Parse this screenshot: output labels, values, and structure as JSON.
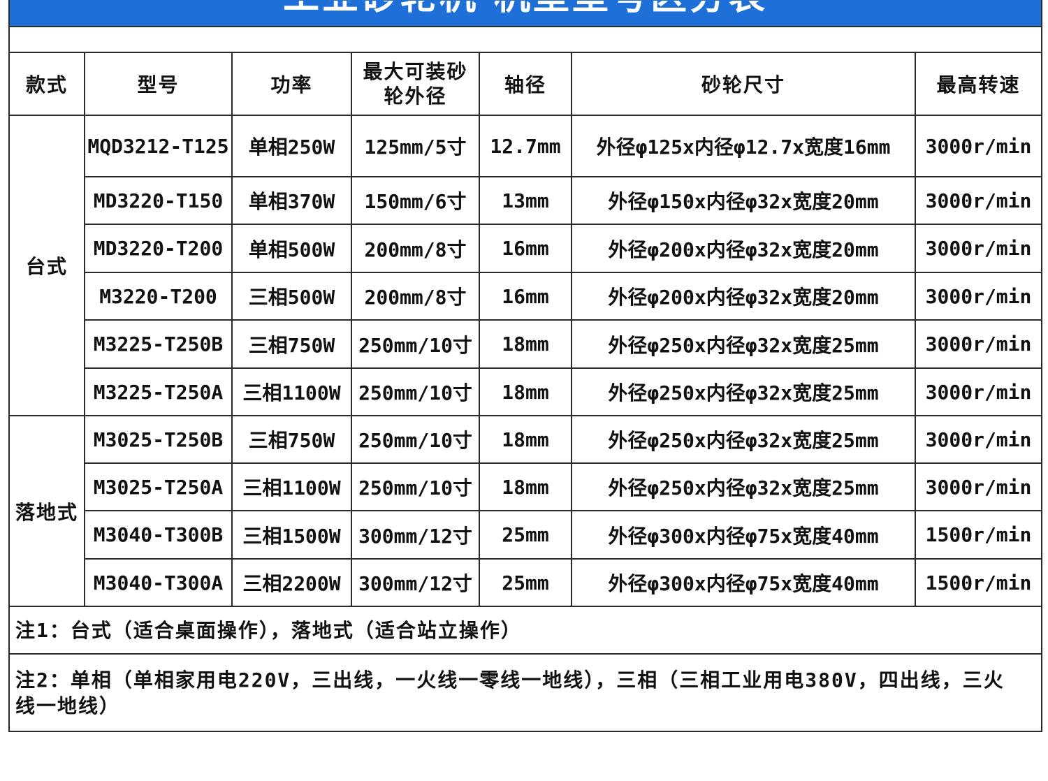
{
  "title": "工业砂轮机 机型型号区分表",
  "columns": {
    "style": "款式",
    "model": "型号",
    "power": "功率",
    "wheel_od": "最大可装砂轮外径",
    "shaft": "轴径",
    "wheel_size": "砂轮尺寸",
    "max_speed": "最高转速"
  },
  "groups": [
    {
      "style": "台式",
      "rows": [
        {
          "model": "MQD3212-T125",
          "power": "单相250W",
          "wheel_od": "125mm/5寸",
          "shaft": "12.7mm",
          "wheel_size": "外径φ125x内径φ12.7x宽度16mm",
          "max_speed": "3000r/min"
        },
        {
          "model": "MD3220-T150",
          "power": "单相370W",
          "wheel_od": "150mm/6寸",
          "shaft": "13mm",
          "wheel_size": "外径φ150x内径φ32x宽度20mm",
          "max_speed": "3000r/min"
        },
        {
          "model": "MD3220-T200",
          "power": "单相500W",
          "wheel_od": "200mm/8寸",
          "shaft": "16mm",
          "wheel_size": "外径φ200x内径φ32x宽度20mm",
          "max_speed": "3000r/min"
        },
        {
          "model": "M3220-T200",
          "power": "三相500W",
          "wheel_od": "200mm/8寸",
          "shaft": "16mm",
          "wheel_size": "外径φ200x内径φ32x宽度20mm",
          "max_speed": "3000r/min"
        },
        {
          "model": "M3225-T250B",
          "power": "三相750W",
          "wheel_od": "250mm/10寸",
          "shaft": "18mm",
          "wheel_size": "外径φ250x内径φ32x宽度25mm",
          "max_speed": "3000r/min"
        },
        {
          "model": "M3225-T250A",
          "power": "三相1100W",
          "wheel_od": "250mm/10寸",
          "shaft": "18mm",
          "wheel_size": "外径φ250x内径φ32x宽度25mm",
          "max_speed": "3000r/min"
        }
      ]
    },
    {
      "style": "落地式",
      "rows": [
        {
          "model": "M3025-T250B",
          "power": "三相750W",
          "wheel_od": "250mm/10寸",
          "shaft": "18mm",
          "wheel_size": "外径φ250x内径φ32x宽度25mm",
          "max_speed": "3000r/min"
        },
        {
          "model": "M3025-T250A",
          "power": "三相1100W",
          "wheel_od": "250mm/10寸",
          "shaft": "18mm",
          "wheel_size": "外径φ250x内径φ32x宽度25mm",
          "max_speed": "3000r/min"
        },
        {
          "model": "M3040-T300B",
          "power": "三相1500W",
          "wheel_od": "300mm/12寸",
          "shaft": "25mm",
          "wheel_size": "外径φ300x内径φ75x宽度40mm",
          "max_speed": "1500r/min"
        },
        {
          "model": "M3040-T300A",
          "power": "三相2200W",
          "wheel_od": "300mm/12寸",
          "shaft": "25mm",
          "wheel_size": "外径φ300x内径φ75x宽度40mm",
          "max_speed": "1500r/min"
        }
      ]
    }
  ],
  "notes": [
    "注1：台式（适合桌面操作），落地式（适合站立操作）",
    "注2：单相（单相家用电220V，三出线，一火线一零线一地线），三相（三相工业用电380V，四出线，三火线一地线）"
  ],
  "colors": {
    "title_bar": "#1f6fd8",
    "title_text": "#ffffff",
    "border": "#2b2b2b",
    "text": "#111111"
  }
}
